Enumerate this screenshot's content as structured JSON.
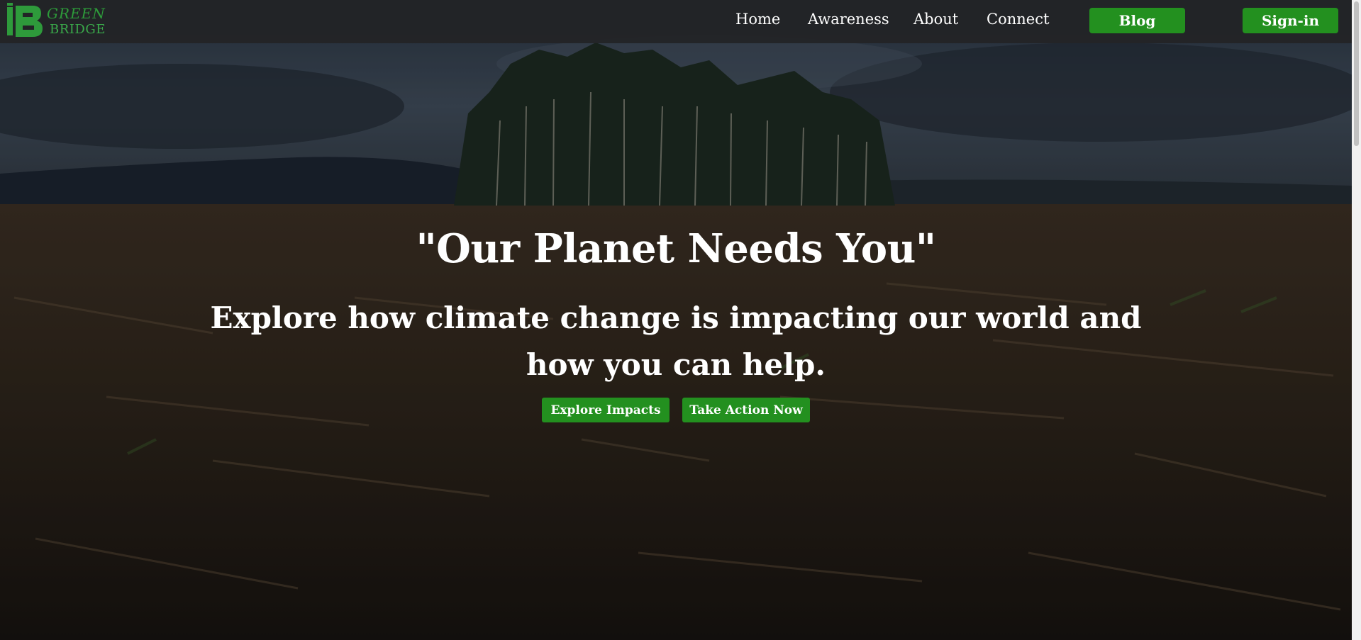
{
  "brand": {
    "logo_text_top": "GREEN",
    "logo_text_bottom": "BRIDGE",
    "accent_color": "#23901f"
  },
  "nav": {
    "links": [
      "Home",
      "Awareness",
      "About",
      "Connect"
    ],
    "blog_label": "Blog",
    "signin_label": "Sign-in"
  },
  "hero": {
    "title": "\"Our Planet Needs You\"",
    "subtitle_line1": "Explore how climate change is impacting our world and",
    "subtitle_line2": "how you can help.",
    "primary_cta": "Explore Impacts",
    "secondary_cta": "Take Action Now",
    "background": "deforested-landscape-photo"
  }
}
